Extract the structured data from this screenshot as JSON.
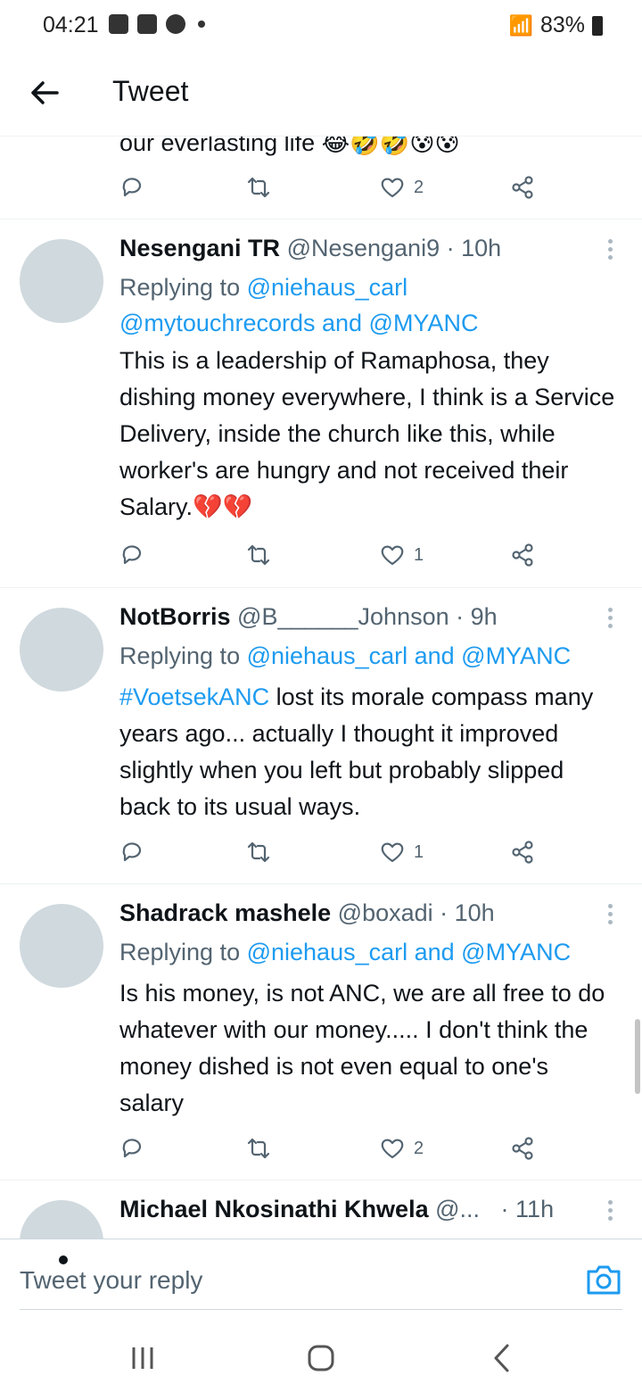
{
  "status_bar": {
    "time": "04:21",
    "battery": "83%"
  },
  "header": {
    "title": "Tweet"
  },
  "partial_tweet": {
    "text": "our everlasting life 😂🤣🤣😰😰",
    "likes": "2"
  },
  "tweets": [
    {
      "name": "Nesengani TR",
      "handle": "@Nesengani9",
      "time": "· 10h",
      "replying_prefix": "Replying to ",
      "mentions_line1": "@niehaus_carl",
      "mentions_line2": "@mytouchrecords and @MYANC",
      "body": "This is a leadership of Ramaphosa, they dishing money everywhere, I think is a Service Delivery, inside the church like this, while worker's are hungry and not received their Salary.💔💔",
      "likes": "1"
    },
    {
      "name": "NotBorris",
      "handle": "@B______Johnson",
      "time": "· 9h",
      "replying_prefix": "Replying to ",
      "mentions_line1": "@niehaus_carl and @MYANC",
      "hashtag": "#VoetsekANC",
      "body": " lost its morale compass many years ago... actually I thought it improved slightly when you left but probably slipped back to its usual ways.",
      "likes": "1"
    },
    {
      "name": "Shadrack mashele",
      "handle": "@boxadi",
      "time": "· 10h",
      "replying_prefix": "Replying to ",
      "mentions_line1": "@niehaus_carl and @MYANC",
      "body": "Is his money, is not ANC, we are all free to do whatever with our money..... I don't think the money dished is not even equal to one's salary",
      "likes": "2"
    },
    {
      "name": "Michael Nkosinathi Khwela",
      "handle": "@...",
      "time": "· 11h"
    }
  ],
  "composer": {
    "placeholder": "Tweet your reply"
  },
  "icons": {
    "back": "arrow-left-icon",
    "reply": "reply-icon",
    "retweet": "retweet-icon",
    "like": "heart-icon",
    "share": "share-icon",
    "camera": "camera-icon"
  },
  "colors": {
    "accent": "#1d9bf0",
    "text": "#0f1419",
    "muted": "#536471"
  }
}
